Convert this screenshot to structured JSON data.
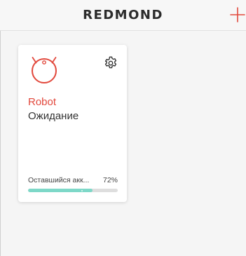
{
  "header": {
    "brand": "REDMOND",
    "add_icon": "plus-icon"
  },
  "colors": {
    "accent": "#e2483c",
    "battery_fill": "#7ed8c8",
    "battery_track": "#dedede"
  },
  "devices": [
    {
      "icon": "robot-vacuum-icon",
      "settings_icon": "gear-icon",
      "name": "Robot",
      "status": "Ожидание",
      "battery_label": "Оставшийся акк...",
      "battery_value": "72%",
      "battery_level": 72
    }
  ]
}
